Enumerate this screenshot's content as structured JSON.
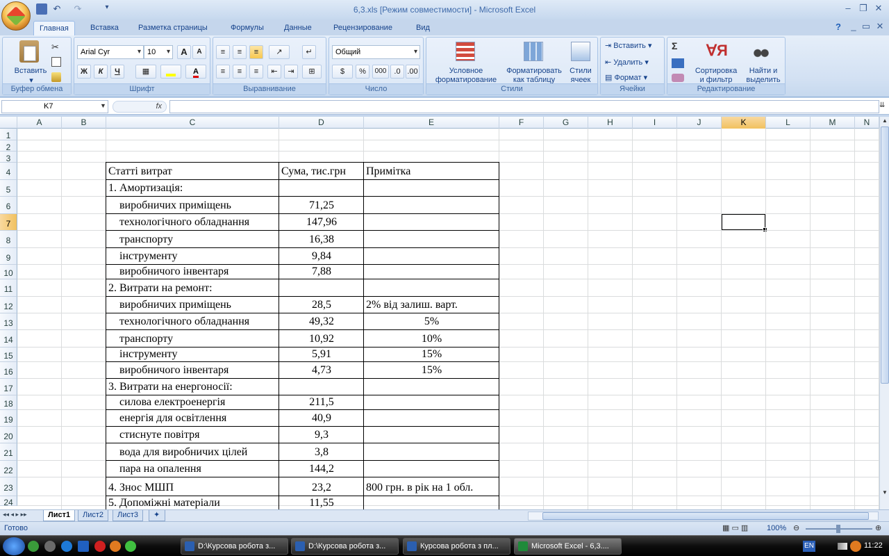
{
  "window": {
    "title": "6,3.xls  [Режим совместимости] - Microsoft Excel",
    "minimize_icon": "minimize-icon",
    "restore_icon": "restore-icon",
    "close_icon": "close-icon",
    "inner_minimize": "_",
    "inner_restore": "▭",
    "inner_close": "✕",
    "help": "?"
  },
  "tabs": [
    "Главная",
    "Вставка",
    "Разметка страницы",
    "Формулы",
    "Данные",
    "Рецензирование",
    "Вид"
  ],
  "ribbon": {
    "clipboard": {
      "label": "Буфер обмена",
      "paste": "Вставить"
    },
    "font": {
      "label": "Шрифт",
      "font_name": "Arial Cyr",
      "font_size": "10",
      "bold": "Ж",
      "italic": "К",
      "underline": "Ч",
      "grow": "A",
      "shrink": "A"
    },
    "alignment": {
      "label": "Выравнивание"
    },
    "number": {
      "label": "Число",
      "format": "Общий",
      "percent": "%",
      "thousands": "000"
    },
    "styles": {
      "label": "Стили",
      "conditional": "Условное\nформатирование",
      "as_table": "Форматировать\nкак таблицу",
      "cell_styles": "Стили\nячеек"
    },
    "cells": {
      "label": "Ячейки",
      "insert": "Вставить",
      "delete": "Удалить",
      "format": "Формат"
    },
    "editing": {
      "label": "Редактирование",
      "sigma": "Σ",
      "sort": "Сортировка\nи фильтр",
      "find": "Найти и\nвыделить"
    }
  },
  "formula_bar": {
    "name_box": "K7",
    "fx": "fx",
    "value": ""
  },
  "columns": [
    "A",
    "B",
    "C",
    "D",
    "E",
    "F",
    "G",
    "H",
    "I",
    "J",
    "K",
    "L",
    "M",
    "N"
  ],
  "selected_column": "K",
  "selected_row": "7",
  "rows": [
    "1",
    "2",
    "3",
    "4",
    "5",
    "6",
    "7",
    "8",
    "9",
    "10",
    "11",
    "12",
    "13",
    "14",
    "15",
    "16",
    "17",
    "18",
    "19",
    "20",
    "21",
    "22",
    "23",
    "24"
  ],
  "table": [
    {
      "row": "4",
      "c": "Статті витрат",
      "d": "Сума, тис.грн",
      "e": "Примітка"
    },
    {
      "row": "5",
      "c": "1. Амортизація:",
      "d": "",
      "e": ""
    },
    {
      "row": "6",
      "c": "   виробничих приміщень",
      "d": "71,25",
      "e": ""
    },
    {
      "row": "7",
      "c": "   технологічного обладнання",
      "d": "147,96",
      "e": ""
    },
    {
      "row": "8",
      "c": "   транспорту",
      "d": "16,38",
      "e": ""
    },
    {
      "row": "9",
      "c": "   інструменту",
      "d": "9,84",
      "e": ""
    },
    {
      "row": "10",
      "c": "   виробничого інвентаря",
      "d": "7,88",
      "e": ""
    },
    {
      "row": "11",
      "c": "2. Витрати на ремонт:",
      "d": "",
      "e": ""
    },
    {
      "row": "12",
      "c": "   виробничих приміщень",
      "d": "28,5",
      "e": "2% від залиш. варт."
    },
    {
      "row": "13",
      "c": "   технологічного обладнання",
      "d": "49,32",
      "e": "5%"
    },
    {
      "row": "14",
      "c": "   транспорту",
      "d": "10,92",
      "e": "10%"
    },
    {
      "row": "15",
      "c": "   інструменту",
      "d": "5,91",
      "e": "15%"
    },
    {
      "row": "16",
      "c": "   виробничого інвентаря",
      "d": "4,73",
      "e": "15%"
    },
    {
      "row": "17",
      "c": "3. Витрати на енергоносії:",
      "d": "",
      "e": ""
    },
    {
      "row": "18",
      "c": "   силова електроенергія",
      "d": "211,5",
      "e": ""
    },
    {
      "row": "19",
      "c": "   енергія для освітлення",
      "d": "40,9",
      "e": ""
    },
    {
      "row": "20",
      "c": "   стиснуте повітря",
      "d": "9,3",
      "e": ""
    },
    {
      "row": "21",
      "c": "   вода для виробничих цілей",
      "d": "3,8",
      "e": ""
    },
    {
      "row": "22",
      "c": "   пара на опалення",
      "d": "144,2",
      "e": ""
    },
    {
      "row": "23",
      "c": "4. Знос МШП",
      "d": "23,2",
      "e": "800 грн. в рік на 1 обл."
    },
    {
      "row": "24",
      "c": "5. Допоміжні матеріали",
      "d": "11,55",
      "e": ""
    }
  ],
  "sheets": [
    "Лист1",
    "Лист2",
    "Лист3"
  ],
  "status": {
    "ready": "Готово",
    "zoom": "100%"
  },
  "taskbar": {
    "tasks": [
      "D:\\Курсова робота з...",
      "D:\\Курсова робота з...",
      "Курсова робота з пл...",
      "Microsoft Excel - 6,3...."
    ],
    "lang": "EN",
    "clock": "11:22"
  }
}
